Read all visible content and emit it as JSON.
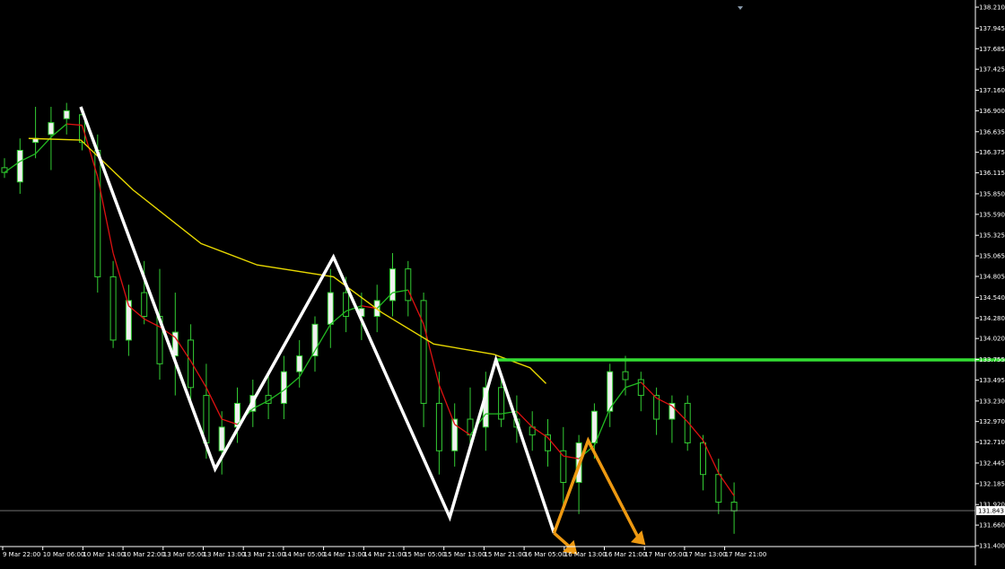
{
  "chart_data": {
    "type": "candlestick",
    "grid": false,
    "colors": {
      "background": "#000000",
      "axis": "#ffffff",
      "candle_up": "#ffffff",
      "candle_body_bull": "#f0f0f0",
      "candle_wick": "#33cc33",
      "ma_slow": "#e8d800",
      "ma_fast_up": "#22bb22",
      "ma_fast_down": "#dd1111",
      "zigzag": "#ffffff",
      "resistance": "#33dd33",
      "projection": "#ee9911",
      "price_line": "#999999"
    },
    "ylim": [
      131.4,
      138.21
    ],
    "y_ticks": [
      "138.210",
      "137.945",
      "137.685",
      "137.425",
      "137.160",
      "136.900",
      "136.635",
      "136.375",
      "136.115",
      "135.850",
      "135.590",
      "135.325",
      "135.065",
      "134.805",
      "134.540",
      "134.280",
      "134.020",
      "133.755",
      "133.495",
      "133.230",
      "132.970",
      "132.710",
      "132.445",
      "132.185",
      "131.920",
      "131.660",
      "131.400"
    ],
    "x_ticks": [
      "9 Mar 22:00",
      "10 Mar 06:00",
      "10 Mar 14:00",
      "10 Mar 22:00",
      "13 Mar 05:00",
      "13 Mar 13:00",
      "13 Mar 21:00",
      "14 Mar 05:00",
      "14 Mar 13:00",
      "14 Mar 21:00",
      "15 Mar 05:00",
      "15 Mar 13:00",
      "15 Mar 21:00",
      "16 Mar 05:00",
      "16 Mar 13:00",
      "16 Mar 21:00",
      "17 Mar 05:00",
      "17 Mar 13:00",
      "17 Mar 21:00"
    ],
    "current_price": "131.843",
    "zigzag": [
      {
        "bar": 0,
        "price": 136.95
      },
      {
        "bar": 3.35,
        "price": 132.37
      },
      {
        "bar": 6.3,
        "price": 135.05
      },
      {
        "bar": 9.2,
        "price": 131.76
      },
      {
        "bar": 10.35,
        "price": 133.75
      },
      {
        "bar": 11.8,
        "price": 131.56
      }
    ],
    "resistance_level": 133.75,
    "projection": [
      {
        "bar": 11.8,
        "price": 131.56
      },
      {
        "bar": 12.65,
        "price": 132.73
      },
      {
        "bar": 13.9,
        "price": 131.5
      }
    ],
    "slow_ma": [
      {
        "bar": -1.3,
        "price": 136.55
      },
      {
        "bar": 0,
        "price": 136.53
      },
      {
        "bar": 1.3,
        "price": 135.9
      },
      {
        "bar": 3,
        "price": 135.22
      },
      {
        "bar": 4.4,
        "price": 134.95
      },
      {
        "bar": 6.3,
        "price": 134.8
      },
      {
        "bar": 7.5,
        "price": 134.35
      },
      {
        "bar": 8.8,
        "price": 133.95
      },
      {
        "bar": 10.3,
        "price": 133.82
      },
      {
        "bar": 11.2,
        "price": 133.65
      },
      {
        "bar": 11.6,
        "price": 133.45
      }
    ],
    "candles": [
      {
        "o": 136.18,
        "h": 136.3,
        "l": 136.05,
        "c": 136.12
      },
      {
        "o": 136.0,
        "h": 136.55,
        "l": 135.85,
        "c": 136.4
      },
      {
        "o": 136.5,
        "h": 136.95,
        "l": 136.3,
        "c": 136.55
      },
      {
        "o": 136.6,
        "h": 136.95,
        "l": 136.15,
        "c": 136.75
      },
      {
        "o": 136.8,
        "h": 137.0,
        "l": 136.6,
        "c": 136.9
      },
      {
        "o": 136.85,
        "h": 136.95,
        "l": 136.4,
        "c": 136.5
      },
      {
        "o": 136.4,
        "h": 136.6,
        "l": 134.6,
        "c": 134.8
      },
      {
        "o": 134.8,
        "h": 135.0,
        "l": 133.9,
        "c": 134.0
      },
      {
        "o": 134.0,
        "h": 134.7,
        "l": 133.8,
        "c": 134.5
      },
      {
        "o": 134.6,
        "h": 135.0,
        "l": 134.2,
        "c": 134.3
      },
      {
        "o": 134.3,
        "h": 134.9,
        "l": 133.5,
        "c": 133.7
      },
      {
        "o": 133.8,
        "h": 134.6,
        "l": 133.3,
        "c": 134.1
      },
      {
        "o": 134.0,
        "h": 134.2,
        "l": 133.2,
        "c": 133.4
      },
      {
        "o": 133.3,
        "h": 133.7,
        "l": 132.5,
        "c": 132.7
      },
      {
        "o": 132.6,
        "h": 133.1,
        "l": 132.3,
        "c": 132.9
      },
      {
        "o": 132.9,
        "h": 133.4,
        "l": 132.7,
        "c": 133.2
      },
      {
        "o": 133.1,
        "h": 133.5,
        "l": 132.9,
        "c": 133.3
      },
      {
        "o": 133.3,
        "h": 133.6,
        "l": 133.0,
        "c": 133.2
      },
      {
        "o": 133.2,
        "h": 133.8,
        "l": 133.0,
        "c": 133.6
      },
      {
        "o": 133.6,
        "h": 134.0,
        "l": 133.4,
        "c": 133.8
      },
      {
        "o": 133.8,
        "h": 134.3,
        "l": 133.6,
        "c": 134.2
      },
      {
        "o": 134.2,
        "h": 134.9,
        "l": 133.9,
        "c": 134.6
      },
      {
        "o": 134.6,
        "h": 134.8,
        "l": 134.1,
        "c": 134.3
      },
      {
        "o": 134.3,
        "h": 134.6,
        "l": 134.0,
        "c": 134.4
      },
      {
        "o": 134.3,
        "h": 134.7,
        "l": 134.1,
        "c": 134.5
      },
      {
        "o": 134.5,
        "h": 135.1,
        "l": 134.3,
        "c": 134.9
      },
      {
        "o": 134.9,
        "h": 135.0,
        "l": 134.3,
        "c": 134.5
      },
      {
        "o": 134.5,
        "h": 134.6,
        "l": 132.9,
        "c": 133.2
      },
      {
        "o": 133.2,
        "h": 133.6,
        "l": 132.3,
        "c": 132.6
      },
      {
        "o": 132.6,
        "h": 133.2,
        "l": 132.4,
        "c": 133.0
      },
      {
        "o": 133.0,
        "h": 133.4,
        "l": 132.6,
        "c": 132.8
      },
      {
        "o": 132.9,
        "h": 133.6,
        "l": 132.6,
        "c": 133.4
      },
      {
        "o": 133.4,
        "h": 133.5,
        "l": 132.9,
        "c": 133.0
      },
      {
        "o": 133.0,
        "h": 133.3,
        "l": 132.7,
        "c": 132.9
      },
      {
        "o": 132.9,
        "h": 133.1,
        "l": 132.6,
        "c": 132.8
      },
      {
        "o": 132.8,
        "h": 133.0,
        "l": 132.4,
        "c": 132.6
      },
      {
        "o": 132.6,
        "h": 132.9,
        "l": 131.9,
        "c": 132.2
      },
      {
        "o": 132.2,
        "h": 132.8,
        "l": 131.8,
        "c": 132.7
      },
      {
        "o": 132.7,
        "h": 133.2,
        "l": 132.5,
        "c": 133.1
      },
      {
        "o": 133.1,
        "h": 133.7,
        "l": 132.9,
        "c": 133.6
      },
      {
        "o": 133.6,
        "h": 133.8,
        "l": 133.3,
        "c": 133.5
      },
      {
        "o": 133.5,
        "h": 133.6,
        "l": 133.1,
        "c": 133.3
      },
      {
        "o": 133.3,
        "h": 133.4,
        "l": 132.8,
        "c": 133.0
      },
      {
        "o": 133.0,
        "h": 133.3,
        "l": 132.7,
        "c": 133.2
      },
      {
        "o": 133.2,
        "h": 133.3,
        "l": 132.6,
        "c": 132.7
      },
      {
        "o": 132.7,
        "h": 132.8,
        "l": 132.1,
        "c": 132.3
      },
      {
        "o": 132.3,
        "h": 132.5,
        "l": 131.8,
        "c": 131.95
      },
      {
        "o": 131.95,
        "h": 132.2,
        "l": 131.55,
        "c": 131.84
      }
    ]
  }
}
